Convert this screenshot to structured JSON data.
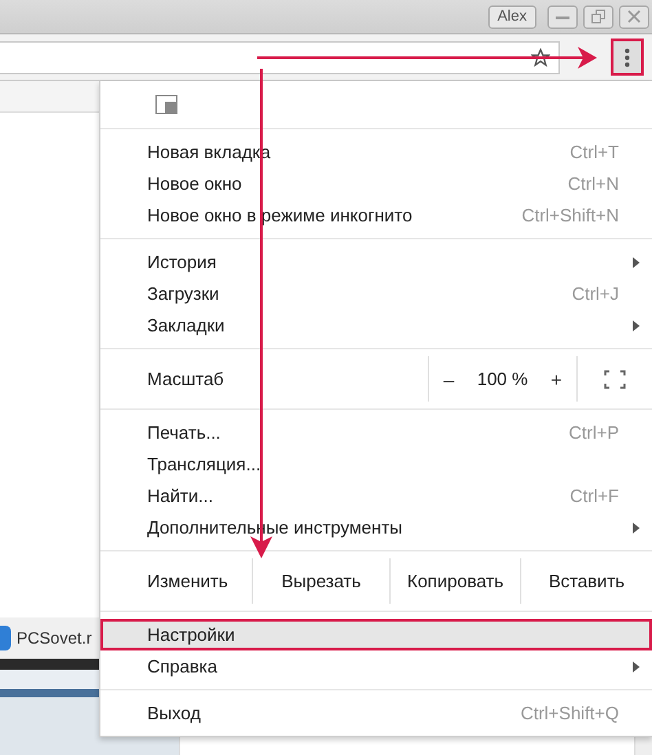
{
  "window": {
    "profile": "Alex"
  },
  "page": {
    "tab_title": "PCSovet.r"
  },
  "menu": {
    "sections": [
      [
        {
          "kind": "item",
          "label": "Новая вкладка",
          "shortcut": "Ctrl+T",
          "submenu": false,
          "selected": false
        },
        {
          "kind": "item",
          "label": "Новое окно",
          "shortcut": "Ctrl+N",
          "submenu": false,
          "selected": false
        },
        {
          "kind": "item",
          "label": "Новое окно в режиме инкогнито",
          "shortcut": "Ctrl+Shift+N",
          "submenu": false,
          "selected": false
        }
      ],
      [
        {
          "kind": "item",
          "label": "История",
          "submenu": true,
          "selected": false
        },
        {
          "kind": "item",
          "label": "Загрузки",
          "shortcut": "Ctrl+J",
          "submenu": false,
          "selected": false
        },
        {
          "kind": "item",
          "label": "Закладки",
          "submenu": true,
          "selected": false
        }
      ],
      [
        {
          "kind": "zoom",
          "label": "Масштаб",
          "minus": "–",
          "value": "100 %",
          "plus": "+"
        }
      ],
      [
        {
          "kind": "item",
          "label": "Печать...",
          "shortcut": "Ctrl+P",
          "submenu": false,
          "selected": false
        },
        {
          "kind": "item",
          "label": "Трансляция...",
          "submenu": false,
          "selected": false
        },
        {
          "kind": "item",
          "label": "Найти...",
          "shortcut": "Ctrl+F",
          "submenu": false,
          "selected": false
        },
        {
          "kind": "item",
          "label": "Дополнительные инструменты",
          "submenu": true,
          "selected": false
        }
      ],
      [
        {
          "kind": "edit",
          "label": "Изменить",
          "actions": [
            "Вырезать",
            "Копировать",
            "Вставить"
          ]
        }
      ],
      [
        {
          "kind": "item",
          "label": "Настройки",
          "submenu": false,
          "selected": true
        },
        {
          "kind": "item",
          "label": "Справка",
          "submenu": true,
          "selected": false
        }
      ],
      [
        {
          "kind": "item",
          "label": "Выход",
          "shortcut": "Ctrl+Shift+Q",
          "submenu": false,
          "selected": false
        }
      ]
    ]
  }
}
